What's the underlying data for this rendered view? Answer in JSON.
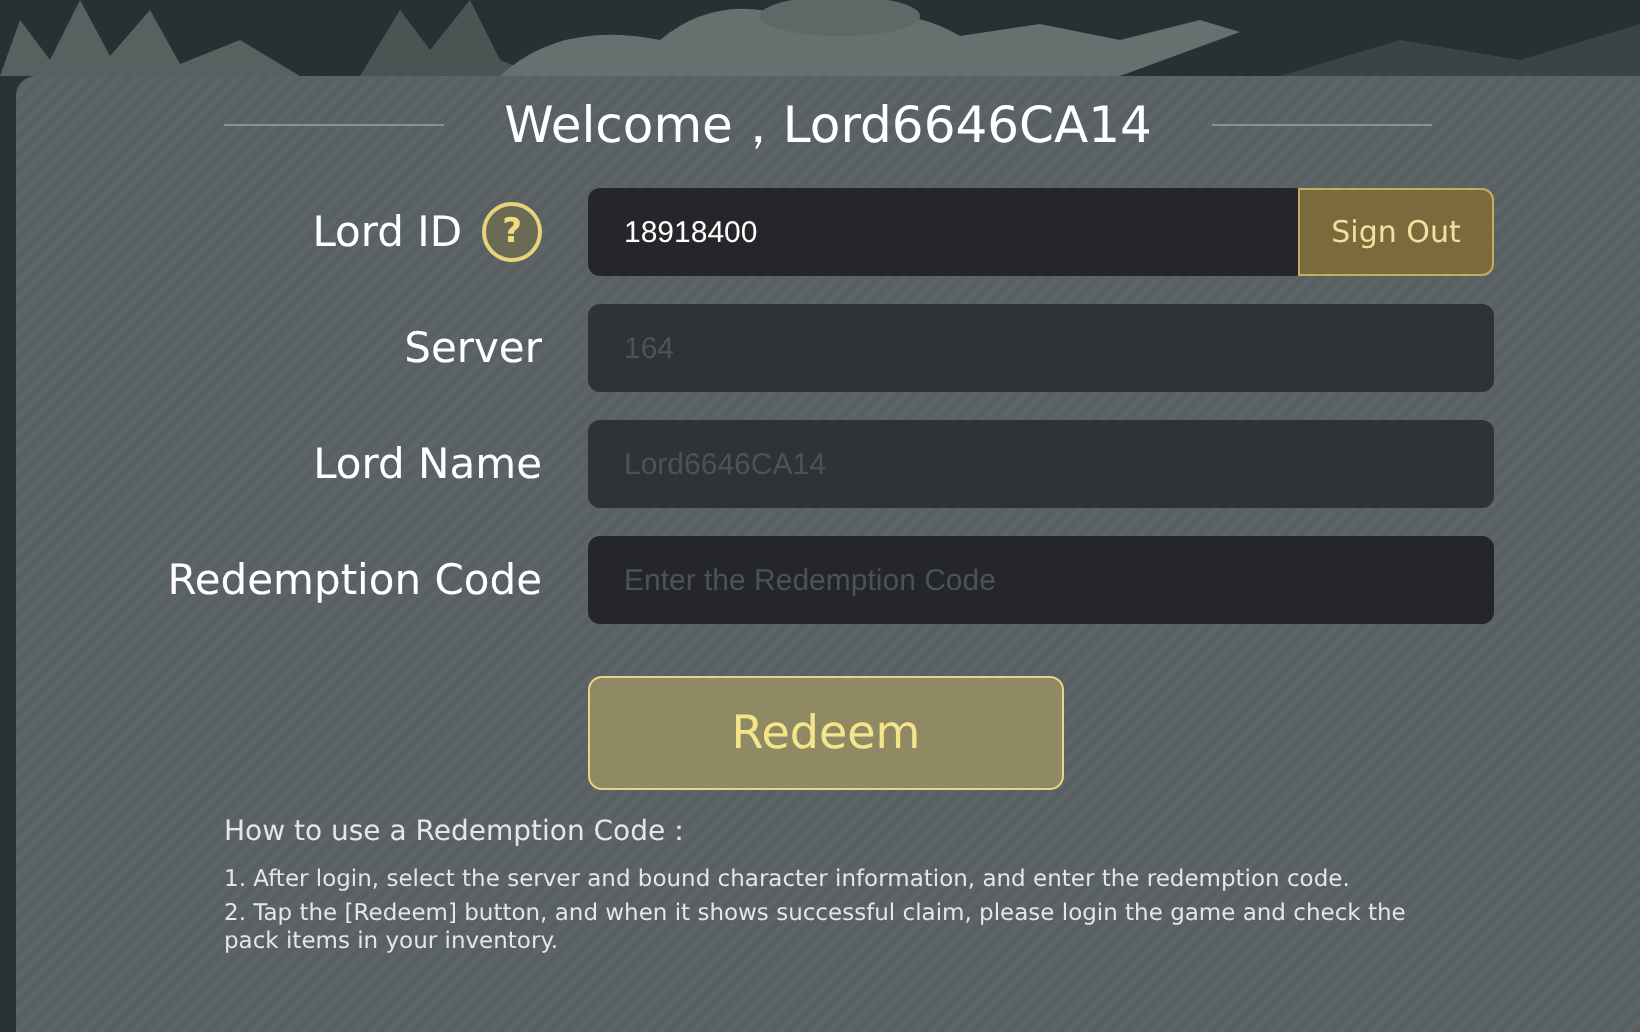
{
  "title": "Welcome，Lord6646CA14",
  "fields": [
    {
      "label": "Lord ID",
      "value": "18918400",
      "help_icon": "?",
      "disabled": false,
      "action": "Sign Out"
    },
    {
      "label": "Server",
      "value": "164",
      "disabled": true
    },
    {
      "label": "Lord Name",
      "value": "Lord6646CA14",
      "disabled": true
    },
    {
      "label": "Redemption Code",
      "placeholder": "Enter the Redemption Code",
      "disabled": false
    }
  ],
  "redeem_button": "Redeem",
  "instructions": {
    "heading": "How to use a Redemption Code：",
    "steps": [
      "1. After login, select the server and bound character information, and enter the redemption code.",
      "2. Tap the [Redeem] button, and when it shows successful claim, please login the game and check the pack items in your inventory."
    ]
  }
}
